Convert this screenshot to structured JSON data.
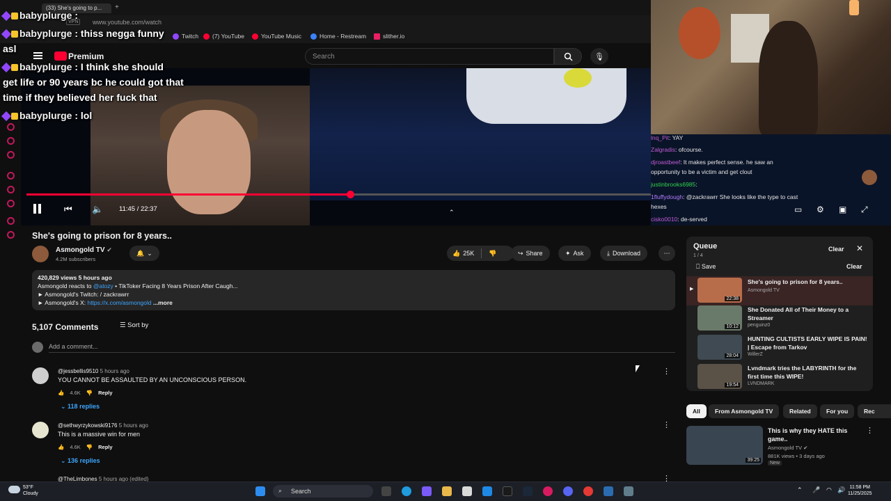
{
  "browser": {
    "tab_title": "(33) She's going to p...",
    "url": "www.youtube.com/watch",
    "vpn": "VPN",
    "bookmarks": [
      "Twitch",
      "(7) YouTube",
      "YouTube Music",
      "Home - Restream",
      "slither.io"
    ]
  },
  "youtube": {
    "logo": "Premium",
    "search_placeholder": "Search"
  },
  "stream_chat_overlay": [
    {
      "user": "babyplurge",
      "text": ""
    },
    {
      "user": "babyplurge",
      "text": "thiss negga funny"
    },
    {
      "user": "",
      "text": "asl"
    },
    {
      "user": "babyplurge",
      "text": "I think she should"
    },
    {
      "user": "",
      "text": "get life or 90 years bc he could got that"
    },
    {
      "user": "",
      "text": "time if they believed her fuck that"
    },
    {
      "user": "babyplurge",
      "text": "lol"
    }
  ],
  "side_chat": [
    {
      "user": "lnq_Pit",
      "text": "YAY",
      "color": "#c05bd6"
    },
    {
      "user": "Zalgradis",
      "text": "ofcourse.",
      "color": "#c05bd6"
    },
    {
      "user": "djroastbeef",
      "text": "It makes perfect sense. he saw an",
      "color": "#c05bd6"
    },
    {
      "user": "",
      "text": "opportunity to be a victim and get clout",
      "color": "#e6e6e6"
    },
    {
      "user": "justinbrooks6985",
      "text": "",
      "color": "#30d14f"
    },
    {
      "user": "1fluffydough",
      "text": "@zackrawrr She looks like the type to cast",
      "color": "#b47bff"
    },
    {
      "user": "",
      "text": "hexes",
      "color": "#e6e6e6"
    },
    {
      "user": "cisko0010",
      "text": "de-served",
      "color": "#c05bd6"
    }
  ],
  "player": {
    "current_time": "11:45",
    "duration": "22:37",
    "progress": 0.518
  },
  "video": {
    "title": "She's going to prison for 8 years..",
    "channel": "Asmongold TV",
    "subscribers": "4.2M subscribers",
    "likes": "25K",
    "share": "Share",
    "ask": "Ask",
    "download": "Download"
  },
  "description": {
    "stats": "420,829 views  5 hours ago",
    "line1_prefix": "Asmongold reacts to",
    "line1_link": "@atozy",
    "line1_rest": "TikToker Facing 8 Years Prison After Caugh...",
    "line2": "► Asmongold's Twitch:",
    "line2_link": "/ zackrawrr",
    "line3": "► Asmongold's X:",
    "line3_link": "https://x.com/asmongold",
    "more": "...more"
  },
  "comments": {
    "count": "5,107 Comments",
    "sort": "Sort by",
    "add_placeholder": "Add a comment...",
    "items": [
      {
        "user": "@jessbellis9510",
        "time": "5 hours ago",
        "text": "YOU CANNOT BE ASSAULTED BY AN UNCONSCIOUS PERSON.",
        "likes": "4.6K",
        "reply": "Reply",
        "replies": "118 replies"
      },
      {
        "user": "@sethwyrzykowski9176",
        "time": "5 hours ago",
        "text": "This is a massive win for men",
        "likes": "4.6K",
        "reply": "Reply",
        "replies": "136 replies"
      },
      {
        "user": "@TheLimbones",
        "time": "5 hours ago (edited)",
        "text": "",
        "likes": "",
        "reply": "",
        "replies": ""
      }
    ]
  },
  "queue": {
    "title": "Queue",
    "position": "1 / 4",
    "clear": "Clear",
    "save": "Save",
    "clear2": "Clear",
    "items": [
      {
        "title": "She's going to prison for 8 years..",
        "channel": "Asmongold TV",
        "duration": "22:38"
      },
      {
        "title": "She Donated All of Their Money to a Streamer",
        "channel": "penguinz0",
        "duration": "10:12"
      },
      {
        "title": "HUNTING CULTISTS EARLY WIPE IS PAIN! | Escape from Tarkov",
        "channel": "WillerZ",
        "duration": "28:04"
      },
      {
        "title": "Lvndmark tries the LABYRINTH for the first time this WIPE!",
        "channel": "LVNDMARK",
        "duration": "19:54"
      }
    ]
  },
  "chips": [
    "All",
    "From Asmongold TV",
    "Related",
    "For you",
    "Rec"
  ],
  "recommended": {
    "title": "This is why they HATE this game..",
    "channel": "Asmongold TV",
    "meta": "881K views • 3 days ago",
    "badge": "New",
    "duration": "39:25"
  },
  "taskbar": {
    "weather_temp": "53°F",
    "weather_desc": "Cloudy",
    "search": "Search",
    "time": "11:58 PM",
    "date": "11/25/2025"
  },
  "colors": {
    "accent": "#ff0033",
    "link": "#3ea6ff",
    "twitch": "#9147ff"
  }
}
